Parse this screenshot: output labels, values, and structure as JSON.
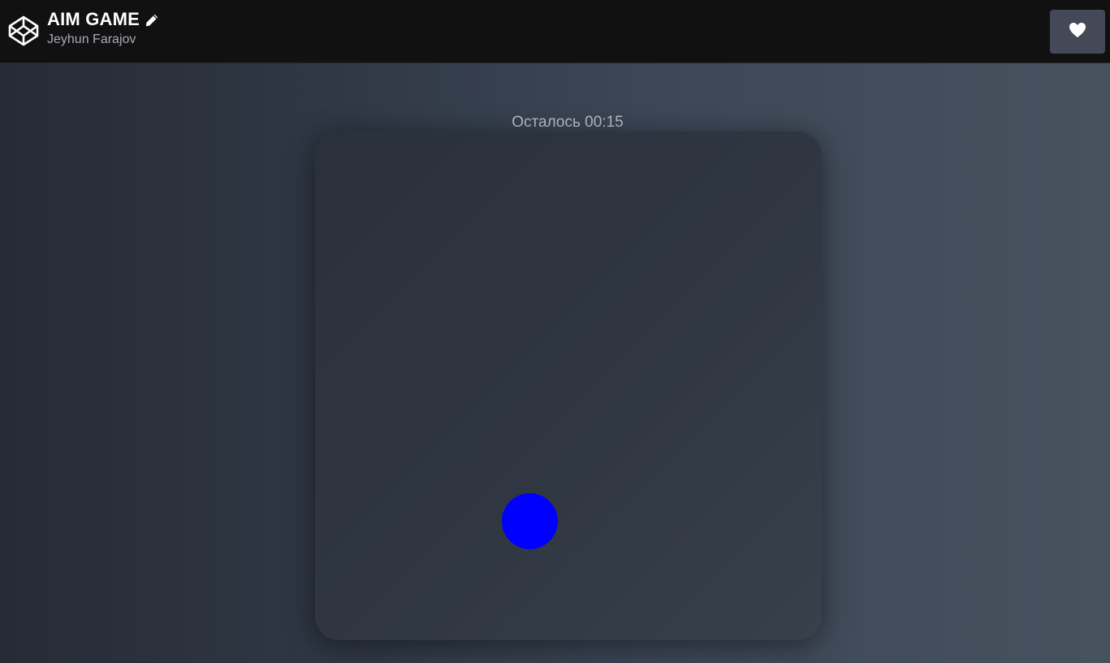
{
  "header": {
    "logo_icon": "codepen-logo-icon",
    "title": "AIM GAME",
    "edit_icon": "pencil-icon",
    "author": "Jeyhun Farajov",
    "like_icon": "heart-icon"
  },
  "game": {
    "timer_text": "Осталось 00:15",
    "target_color": "#0000ff",
    "accent_colors": {
      "header_bg": "#111111",
      "like_button_bg": "#444857"
    }
  }
}
